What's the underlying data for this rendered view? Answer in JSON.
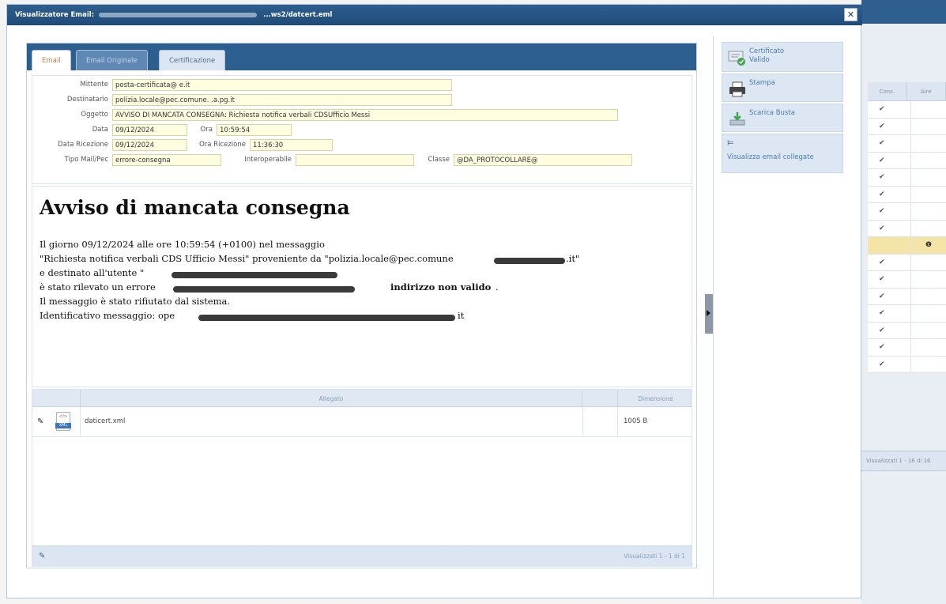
{
  "dialog": {
    "title": "Visualizzatore Email:",
    "title_tail": "...ws2/datcert.eml",
    "close_label": "✕"
  },
  "tabs": [
    {
      "label": "Email"
    },
    {
      "label": "Email Originale"
    },
    {
      "label": "Certificazione"
    }
  ],
  "fields": {
    "mittente_label": "Mittente",
    "mittente_value": "posta-certificata@          e.it",
    "destinatario_label": "Destinatario",
    "destinatario_value": "polizia.locale@pec.comune.          .a.pg.it",
    "oggetto_label": "Oggetto",
    "oggetto_value": "AVVISO DI MANCATA CONSEGNA: Richiesta notifica verbali CDSUfficio Messi",
    "data_label": "Data",
    "data_value": "09/12/2024",
    "ora_label": "Ora",
    "ora_value": "10:59:54",
    "data_ricezione_label": "Data Ricezione",
    "data_ricezione_value": "09/12/2024",
    "ora_ricezione_label": "Ora Ricezione",
    "ora_ricezione_value": "11:36:30",
    "tipo_label": "Tipo Mail/Pec",
    "tipo_value": "errore-consegna",
    "interoperabile_label": "Interoperabile",
    "interoperabile_value": "",
    "classe_label": "Classe",
    "classe_value": "@DA_PROTOCOLLARE@"
  },
  "message": {
    "heading": "Avviso di mancata consegna",
    "line1": "Il giorno 09/12/2024 alle ore 10:59:54 (+0100) nel messaggio",
    "line2a": "\"Richiesta notifica verbali CDS Ufficio Messi\" proveniente da \"polizia.locale@pec.comune",
    "line2b": ".it\"",
    "line3": "e destinato all'utente \"",
    "line4": "è stato rilevato un errore",
    "line4b": "indirizzo non valido",
    "line4c": ".",
    "line5": "Il messaggio è stato rifiutato dal sistema.",
    "line6": "Identificativo messaggio: ope",
    "line6b": "it"
  },
  "attachments": {
    "col_attachment": "Allegato",
    "col_size": "Dimensione",
    "rows": [
      {
        "name": "daticert.xml",
        "size": "1005 B",
        "ext": "XML"
      }
    ],
    "footer_count": "Visualizzati 1 - 1 di 1"
  },
  "side_buttons": {
    "certificate": "Certificato\nValido",
    "print": "Stampa",
    "download": "Scarica Busta",
    "linked": "Visualizza email collegate"
  },
  "background_grid": {
    "col1": "Cons.",
    "col2": "Aìre",
    "check": "✔",
    "info": "❶",
    "footer": "Visualizzati 1 - 16 di 16"
  }
}
